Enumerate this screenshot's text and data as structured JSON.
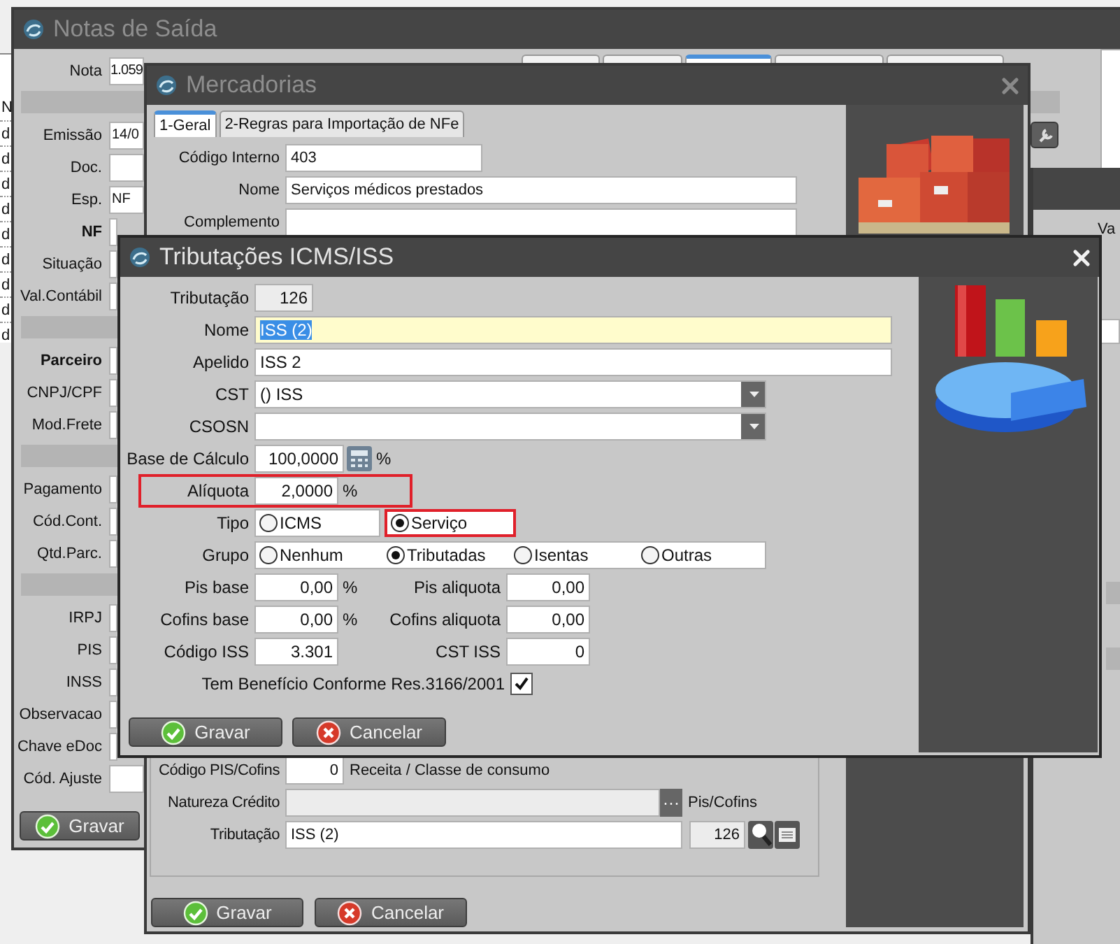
{
  "background_list": {
    "header": "N",
    "rows": [
      "d",
      "d",
      "d",
      "d",
      "d",
      "d",
      "d",
      "d",
      "d"
    ]
  },
  "notas": {
    "title": "Notas de Saída",
    "tabs": [
      {
        "selected": false
      },
      {
        "selected": false
      },
      {
        "selected": true
      },
      {
        "selected": false
      },
      {
        "selected": false
      }
    ],
    "sections": [
      {
        "fields": [
          {
            "label": "Nota",
            "value": "1.059",
            "bold": false
          }
        ]
      },
      {
        "fields": [
          {
            "label": "Emissão",
            "value": "14/0",
            "bold": false
          },
          {
            "label": "Doc.",
            "bold": false
          },
          {
            "label": "Esp.",
            "value": "NF",
            "bold": false
          },
          {
            "label": "NF",
            "bold": true
          },
          {
            "label": "Situação",
            "bold": false
          },
          {
            "label": "Val.Contábil",
            "bold": false
          }
        ]
      },
      {
        "fields": [
          {
            "label": "Parceiro",
            "bold": true
          },
          {
            "label": "CNPJ/CPF",
            "bold": false
          },
          {
            "label": "Mod.Frete",
            "bold": false
          }
        ]
      },
      {
        "fields": [
          {
            "label": "Pagamento",
            "bold": false
          },
          {
            "label": "Cód.Cont.",
            "bold": false
          },
          {
            "label": "Qtd.Parc.",
            "bold": false
          }
        ]
      },
      {
        "fields": [
          {
            "label": "IRPJ",
            "bold": false
          },
          {
            "label": "PIS",
            "bold": false
          },
          {
            "label": "INSS",
            "bold": false
          },
          {
            "label": "Observacao",
            "bold": false
          },
          {
            "label": "Chave eDoc",
            "bold": false
          },
          {
            "label": "Cód. Ajuste",
            "bold": false
          }
        ]
      }
    ],
    "button": {
      "label": "Gravar",
      "kind": "save"
    }
  },
  "side_window": {
    "label": "Va"
  },
  "mercadorias": {
    "title": "Mercadorias",
    "tabs": [
      {
        "label": "1-Geral",
        "selected": true
      },
      {
        "label": "2-Regras para Importação de NFe",
        "selected": false
      }
    ],
    "top_fields": [
      {
        "label": "Código Interno",
        "value": "403",
        "wide": false
      },
      {
        "label": "Nome",
        "value": "Serviços médicos prestados",
        "wide": true
      },
      {
        "label": "Complemento",
        "wide": true
      }
    ],
    "pis_cofins": {
      "label": "Código PIS/Cofins",
      "value": "0",
      "note": "Receita / Classe de consumo"
    },
    "natureza": {
      "label": "Natureza Crédito",
      "button": "···",
      "note": "Pis/Cofins",
      "disabled": true
    },
    "tributacao": {
      "label": "Tributação",
      "value": "ISS (2)",
      "code": "126"
    },
    "buttons": [
      {
        "label": "Gravar",
        "kind": "save"
      },
      {
        "label": "Cancelar",
        "kind": "cancel"
      }
    ]
  },
  "tributacoes": {
    "title": "Tributações ICMS/ISS",
    "tributacao": {
      "label": "Tributação",
      "value": "126"
    },
    "nome": {
      "label": "Nome",
      "value": "ISS (2)",
      "text_selected": true
    },
    "apelido": {
      "label": "Apelido",
      "value": "ISS 2"
    },
    "cst": {
      "label": "CST",
      "value": "() ISS"
    },
    "csosn": {
      "label": "CSOSN"
    },
    "base": {
      "label": "Base de Cálculo",
      "value": "100,0000",
      "unit": "%"
    },
    "aliquota": {
      "label": "Alíquota",
      "value": "2,0000",
      "unit": "%",
      "highlighted": true
    },
    "tipo": {
      "label": "Tipo",
      "options": [
        {
          "label": "ICMS",
          "selected": false,
          "highlighted": false
        },
        {
          "label": "Serviço",
          "selected": true,
          "highlighted": true
        }
      ]
    },
    "grupo": {
      "label": "Grupo",
      "options": [
        {
          "label": "Nenhum",
          "selected": false
        },
        {
          "label": "Tributadas",
          "selected": true
        },
        {
          "label": "Isentas",
          "selected": false
        },
        {
          "label": "Outras",
          "selected": false
        }
      ]
    },
    "pairs": [
      {
        "left": {
          "label": "Pis base",
          "value": "0,00",
          "unit": "%"
        },
        "right": {
          "label": "Pis aliquota",
          "value": "0,00"
        }
      },
      {
        "left": {
          "label": "Cofins base",
          "value": "0,00",
          "unit": "%"
        },
        "right": {
          "label": "Cofins aliquota",
          "value": "0,00"
        }
      },
      {
        "left": {
          "label": "Código ISS",
          "value": "3.301"
        },
        "right": {
          "label": "CST ISS",
          "value": "0"
        }
      }
    ],
    "beneficio": {
      "label": "Tem Benefício Conforme Res.3166/2001",
      "checked": true
    },
    "buttons": [
      {
        "label": "Gravar",
        "kind": "save"
      },
      {
        "label": "Cancelar",
        "kind": "cancel"
      }
    ]
  }
}
